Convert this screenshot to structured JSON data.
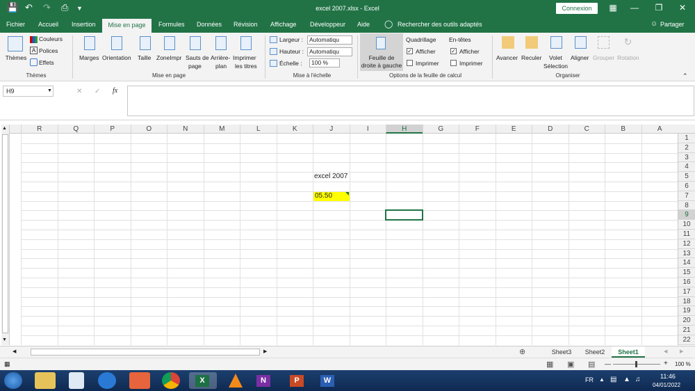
{
  "window": {
    "title": "excel 2007.xlsx  -  Excel",
    "connexion": "Connexion"
  },
  "tabs": [
    "Fichier",
    "Accueil",
    "Insertion",
    "Mise en page",
    "Formules",
    "Données",
    "Révision",
    "Affichage",
    "Développeur",
    "Aide"
  ],
  "active_tab": "Mise en page",
  "search_label": "Rechercher des outils adaptés",
  "share_label": "Partager",
  "ribbon": {
    "themes": {
      "button": "Thèmes",
      "couleurs": "Couleurs",
      "polices": "Polices",
      "effets": "Effets",
      "group": "Thèmes"
    },
    "mise_en_page": {
      "marges": "Marges",
      "orientation": "Orientation",
      "taille": "Taille",
      "zone1": "ZoneImpr",
      "sauts1": "Sauts de",
      "sauts2": "page",
      "arriere1": "Arrière-",
      "arriere2": "plan",
      "imprimer1": "Imprimer",
      "imprimer2": "les titres",
      "group": "Mise en page"
    },
    "echelle": {
      "largeur_label": "Largeur :",
      "largeur_value": "Automatiqu",
      "hauteur_label": "Hauteur :",
      "hauteur_value": "Automatiqu",
      "echelle_label": "Échelle :",
      "echelle_value": "100 %",
      "group": "Mise à l'échelle"
    },
    "options": {
      "feuille1": "Feuille de",
      "feuille2": "droite à gauche",
      "quadrillage": "Quadrillage",
      "entetes": "En-têtes",
      "afficher": "Afficher",
      "imprimer": "Imprimer",
      "group": "Options de la feuille de calcul"
    },
    "organiser": {
      "avancer": "Avancer",
      "reculer": "Reculer",
      "volet1": "Volet",
      "volet2": "Sélection",
      "aligner": "Aligner",
      "grouper": "Grouper",
      "rotation": "Rotation",
      "group": "Organiser"
    }
  },
  "name_box": "H9",
  "fx_label": "fx",
  "columns": [
    "R",
    "Q",
    "P",
    "O",
    "N",
    "M",
    "L",
    "K",
    "J",
    "I",
    "H",
    "G",
    "F",
    "E",
    "D",
    "C",
    "B",
    "A"
  ],
  "rows": [
    "1",
    "2",
    "3",
    "4",
    "5",
    "6",
    "7",
    "8",
    "9",
    "10",
    "11",
    "12",
    "13",
    "14",
    "15",
    "16",
    "17",
    "18",
    "19",
    "20",
    "21",
    "22"
  ],
  "cells": {
    "J5": "excel 2007",
    "J7": "05.50"
  },
  "highlight_color": "#ffff00",
  "accent_color": "#217346",
  "sheets": [
    "Sheet3",
    "Sheet2",
    "Sheet1"
  ],
  "active_sheet": "Sheet1",
  "zoom": "100 %",
  "taskbar": {
    "lang": "FR",
    "time": "11:46",
    "date": "04/01/2022"
  }
}
